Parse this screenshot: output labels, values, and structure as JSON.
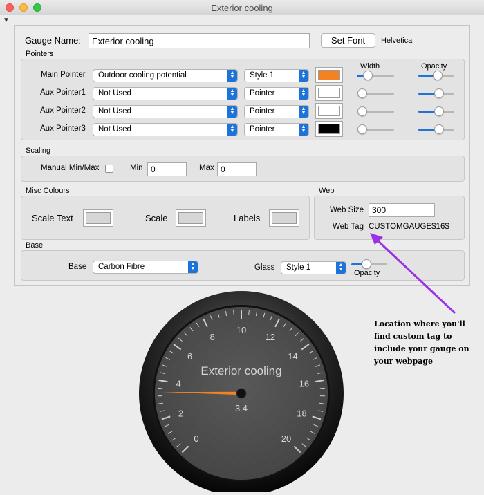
{
  "window": {
    "title": "Exterior cooling"
  },
  "gauge_name": {
    "label": "Gauge Name:",
    "value": "Exterior cooling",
    "set_font_label": "Set Font",
    "font_name": "Helvetica"
  },
  "pointers": {
    "title": "Pointers",
    "width_label": "Width",
    "opacity_label": "Opacity",
    "rows": [
      {
        "label": "Main Pointer",
        "source": "Outdoor cooling potential",
        "style": "Style 1",
        "color": "#f58220",
        "width": 0.22,
        "opacity": 0.55
      },
      {
        "label": "Aux Pointer1",
        "source": "Not Used",
        "style": "Pointer",
        "color": "#ffffff",
        "width": 0.02,
        "opacity": 0.6
      },
      {
        "label": "Aux Pointer2",
        "source": "Not Used",
        "style": "Pointer",
        "color": "#ffffff",
        "width": 0.02,
        "opacity": 0.6
      },
      {
        "label": "Aux Pointer3",
        "source": "Not Used",
        "style": "Pointer",
        "color": "#000000",
        "width": 0.02,
        "opacity": 0.6
      }
    ]
  },
  "scaling": {
    "title": "Scaling",
    "manual_label": "Manual Min/Max",
    "manual_checked": false,
    "min_label": "Min",
    "min_value": "0",
    "max_label": "Max",
    "max_value": "0"
  },
  "misc_colours": {
    "title": "Misc Colours",
    "scale_text_label": "Scale Text",
    "scale_text_color": "#d6d6d6",
    "scale_label": "Scale",
    "scale_color": "#d6d6d6",
    "labels_label": "Labels",
    "labels_color": "#d6d6d6"
  },
  "web": {
    "title": "Web",
    "size_label": "Web Size",
    "size_value": "300",
    "tag_label": "Web Tag",
    "tag_value": "CUSTOMGAUGE$16$"
  },
  "base": {
    "title": "Base",
    "base_label": "Base",
    "base_value": "Carbon Fibre",
    "glass_label": "Glass",
    "glass_value": "Style 1",
    "opacity_label": "Opacity",
    "opacity": 0.4
  },
  "gauge": {
    "title": "Exterior cooling",
    "value": 3.4,
    "value_text": "3.4",
    "min": 0,
    "max": 20,
    "ticks": [
      "0",
      "2",
      "4",
      "6",
      "8",
      "10",
      "12",
      "14",
      "16",
      "18",
      "20"
    ],
    "pointer_color": "#f58220"
  },
  "annotation": {
    "text": "Location where you'll find custom tag to include your gauge on your webpage",
    "arrow_color": "#9b30e6"
  }
}
